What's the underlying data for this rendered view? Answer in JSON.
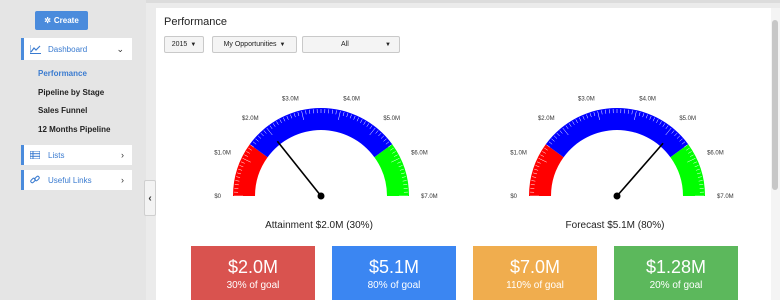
{
  "sidebar": {
    "create_label": "Create",
    "dashboard_label": "Dashboard",
    "sub_items": [
      "Performance",
      "Pipeline by Stage",
      "Sales Funnel",
      "12 Months Pipeline"
    ],
    "lists_label": "Lists",
    "links_label": "Useful Links",
    "active_color": "#3a7bd0"
  },
  "main": {
    "title": "Performance",
    "filters": {
      "year": "2015",
      "scope": "My Opportunities",
      "owner": "All"
    }
  },
  "gauge_scale": {
    "min": 0,
    "max": 7.0,
    "tick_labels": [
      "$0",
      "$1.0M",
      "$2.0M",
      "$3.0M",
      "$4.0M",
      "$5.0M",
      "$6.0M",
      "$7.0M"
    ],
    "bands": [
      {
        "from": 0,
        "to": 1.4,
        "color": "#ff0000"
      },
      {
        "from": 1.4,
        "to": 5.6,
        "color": "#0000ff"
      },
      {
        "from": 5.6,
        "to": 7.0,
        "color": "#00ff00"
      }
    ]
  },
  "gauges": [
    {
      "caption": "Attainment $2.0M (30%)",
      "value": 2.0
    },
    {
      "caption": "Forecast $5.1M (80%)",
      "value": 5.1
    }
  ],
  "tiles": [
    {
      "value": "$2.0M",
      "sub": "30% of goal",
      "color": "#d9534f"
    },
    {
      "value": "$5.1M",
      "sub": "80% of goal",
      "color": "#3b86f2"
    },
    {
      "value": "$7.0M",
      "sub": "110% of goal",
      "color": "#f0ad4e"
    },
    {
      "value": "$1.28M",
      "sub": "20% of goal",
      "color": "#5cb85c"
    }
  ]
}
